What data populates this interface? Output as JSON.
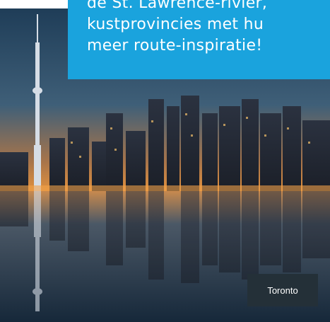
{
  "intro": {
    "lines": [
      "de St. Lawrence-rivier,",
      "kustprovincies met hu",
      "meer route-inspiratie!"
    ]
  },
  "photo": {
    "subject": "Toronto skyline",
    "caption": "Toronto"
  },
  "colors": {
    "panel": "#1aa3dd",
    "caption_bg": "#243038"
  }
}
